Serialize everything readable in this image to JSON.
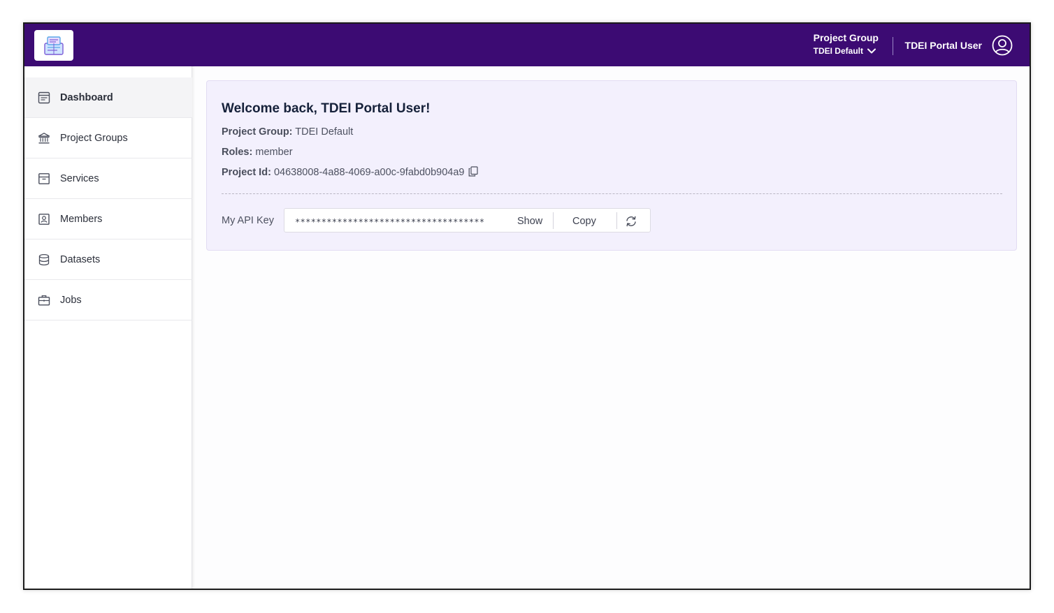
{
  "header": {
    "project_group_title": "Project Group",
    "project_group_value": "TDEI Default",
    "user_name": "TDEI Portal User",
    "brand_color": "#3c0b73"
  },
  "sidebar": {
    "items": [
      {
        "label": "Dashboard",
        "icon": "dashboard-icon",
        "active": true
      },
      {
        "label": "Project Groups",
        "icon": "bank-icon",
        "active": false
      },
      {
        "label": "Services",
        "icon": "archive-icon",
        "active": false
      },
      {
        "label": "Members",
        "icon": "member-badge-icon",
        "active": false
      },
      {
        "label": "Datasets",
        "icon": "database-icon",
        "active": false
      },
      {
        "label": "Jobs",
        "icon": "briefcase-icon",
        "active": false
      }
    ]
  },
  "card": {
    "welcome": "Welcome back, TDEI Portal User!",
    "project_group_label": "Project Group:",
    "project_group_value": "TDEI Default",
    "roles_label": "Roles:",
    "roles_value": "member",
    "project_id_label": "Project Id:",
    "project_id_value": "04638008-4a88-4069-a00c-9fabd0b904a9",
    "api_key_label": "My API Key",
    "api_key_masked": "************************************",
    "show_label": "Show",
    "copy_label": "Copy",
    "background": "#f3f0fd"
  }
}
